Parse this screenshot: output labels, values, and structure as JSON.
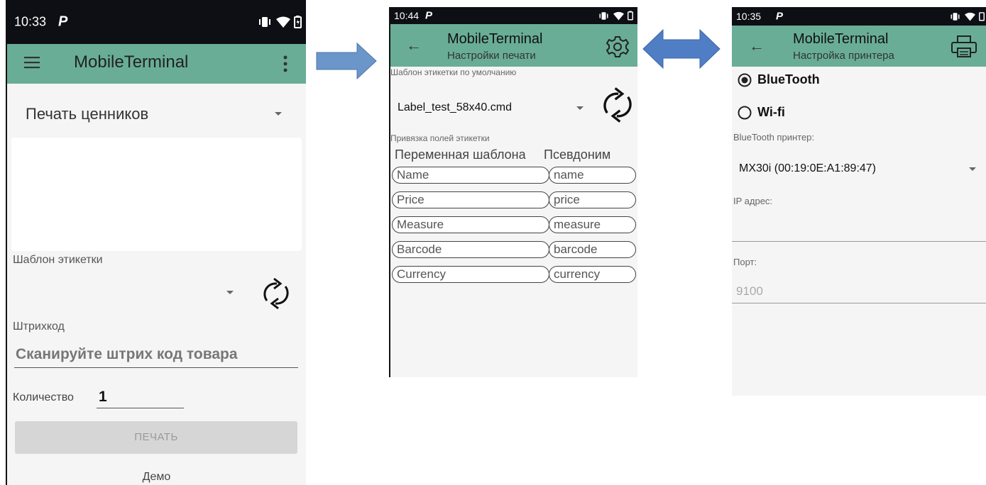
{
  "arrows": {
    "right_arrow_color": "#6b96c9",
    "double_arrow_color": "#4f7ec4"
  },
  "screen1": {
    "status": {
      "time": "10:33",
      "p": "P"
    },
    "appbar": {
      "title": "MobileTerminal",
      "menu_icon": "hamburger-icon",
      "more_icon": "more-vert-icon"
    },
    "mode_select": {
      "value": "Печать ценников"
    },
    "template": {
      "label": "Шаблон этикетки",
      "value": ""
    },
    "barcode": {
      "label": "Штрихкод",
      "placeholder": "Сканируйте штрих код товара"
    },
    "quantity": {
      "label": "Количество",
      "value": "1"
    },
    "print_button": {
      "label": "ПЕЧАТЬ"
    },
    "footer": {
      "text": "Демо"
    }
  },
  "screen2": {
    "status": {
      "time": "10:44",
      "p": "P"
    },
    "appbar": {
      "title": "MobileTerminal",
      "subtitle": "Настройки печати"
    },
    "default_template": {
      "label": "Шаблон этикетки по умолчанию",
      "value": "Label_test_58x40.cmd"
    },
    "binding": {
      "label": "Привязка полей этикетки",
      "col_variable": "Переменная шаблона",
      "col_alias": "Псевдоним",
      "rows": [
        {
          "variable": "Name",
          "alias": "name"
        },
        {
          "variable": "Price",
          "alias": "price"
        },
        {
          "variable": "Measure",
          "alias": "measure"
        },
        {
          "variable": "Barcode",
          "alias": "barcode"
        },
        {
          "variable": "Currency",
          "alias": "currency"
        }
      ]
    }
  },
  "screen3": {
    "status": {
      "time": "10:35",
      "p": "P"
    },
    "appbar": {
      "title": "MobileTerminal",
      "subtitle": "Настройка принтера"
    },
    "connection": {
      "bluetooth": "BlueTooth",
      "wifi": "Wi-fi",
      "selected": "BlueTooth"
    },
    "bt_printer": {
      "label": "BlueTooth принтер:",
      "value": "MX30i (00:19:0E:A1:89:47)"
    },
    "ip": {
      "label": "IP адрес:",
      "value": ""
    },
    "port": {
      "label": "Порт:",
      "placeholder": "9100"
    }
  }
}
